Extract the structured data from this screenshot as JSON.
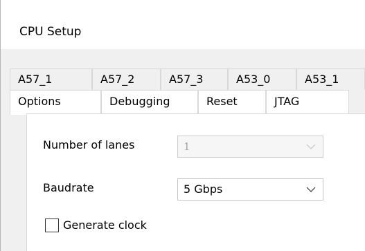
{
  "window": {
    "title": "CPU Setup"
  },
  "tabs_row1": [
    "A57_1",
    "A57_2",
    "A57_3",
    "A53_0",
    "A53_1"
  ],
  "tabs_row2": [
    "Options",
    "Debugging",
    "Reset",
    "JTAG"
  ],
  "form": {
    "lanes_label": "Number of lanes",
    "lanes_value": "1",
    "baudrate_label": "Baudrate",
    "baudrate_value": "5 Gbps",
    "generate_clock_label": "Generate clock",
    "generate_clock_checked": false
  },
  "icons": {
    "dropdown": "chevron-down-icon",
    "checkbox": "checkbox-unchecked-icon"
  }
}
